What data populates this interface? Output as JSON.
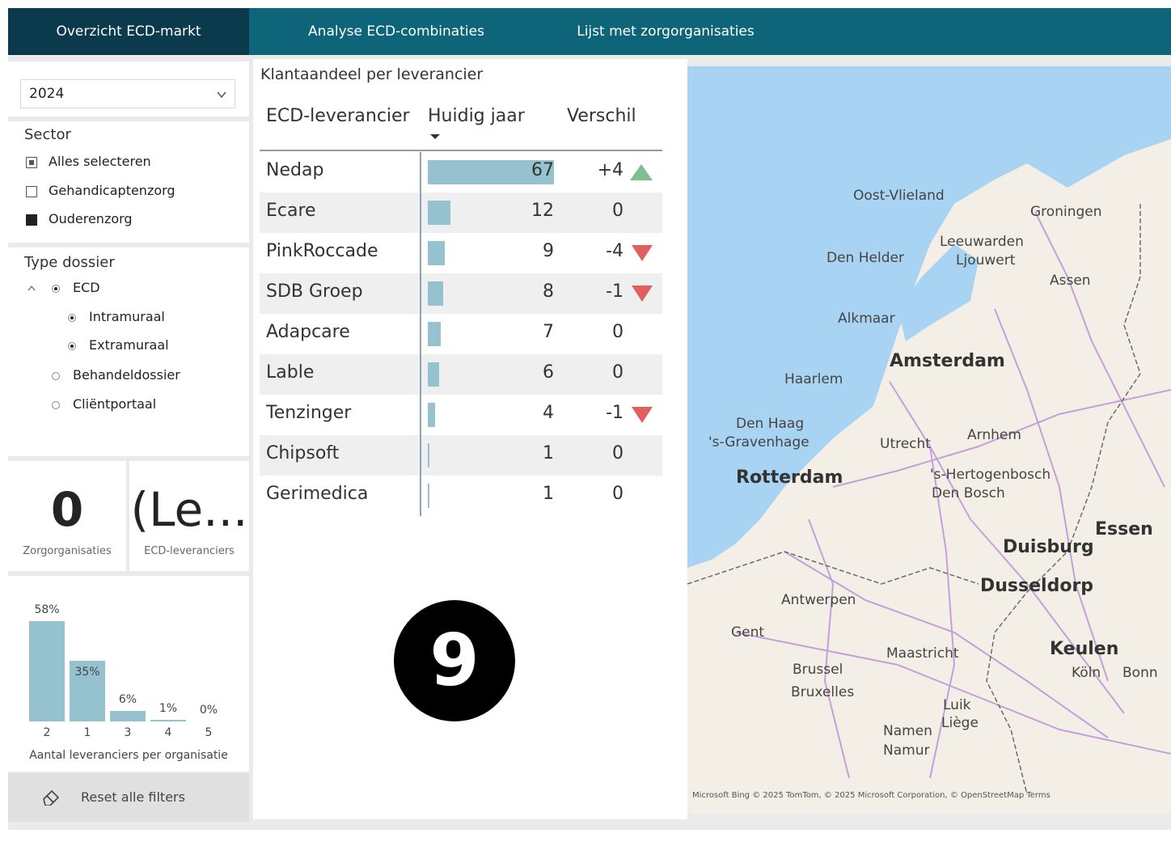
{
  "nav": {
    "tabs": [
      {
        "label": "Overzicht ECD-markt",
        "active": true
      },
      {
        "label": "Analyse ECD-combinaties",
        "active": false
      },
      {
        "label": "Lijst met zorgorganisaties",
        "active": false
      }
    ],
    "active_color": "#0b3a4d",
    "bar_color": "#0e6478"
  },
  "filters": {
    "year": "2024",
    "sector": {
      "title": "Sector",
      "options": [
        {
          "label": "Alles selecteren",
          "state": "partial"
        },
        {
          "label": "Gehandicaptenzorg",
          "state": "unchecked"
        },
        {
          "label": "Ouderenzorg",
          "state": "checked"
        }
      ]
    },
    "dossier": {
      "title": "Type dossier",
      "options": [
        {
          "label": "ECD",
          "selected": true,
          "expanded": true
        },
        {
          "label": "Intramuraal",
          "selected": true
        },
        {
          "label": "Extramuraal",
          "selected": true
        },
        {
          "label": "Behandeldossier",
          "selected": false
        },
        {
          "label": "Cliëntportaal",
          "selected": false
        }
      ]
    }
  },
  "kpis": [
    {
      "value": "0",
      "label": "Zorgorganisaties"
    },
    {
      "value": "(Le...",
      "label": "ECD-leveranciers"
    }
  ],
  "mini_chart": {
    "type": "bar",
    "categories": [
      "2",
      "1",
      "3",
      "4",
      "5"
    ],
    "values": [
      58,
      35,
      6,
      1,
      0
    ],
    "value_labels": [
      "58%",
      "35%",
      "6%",
      "1%",
      "0%"
    ],
    "xlabel": "Aantal leveranciers per organisatie",
    "color": "#96c1cf"
  },
  "reset": {
    "label": "Reset alle filters"
  },
  "table": {
    "title": "Klantaandeel per leverancier",
    "headers": [
      "ECD-leverancier",
      "Huidig jaar",
      "Verschil"
    ],
    "rows": [
      {
        "name": "Nedap",
        "value": 67,
        "value_label": "67",
        "diff": "+4",
        "trend": "up"
      },
      {
        "name": "Ecare",
        "value": 12,
        "value_label": "12",
        "diff": "0",
        "trend": "none"
      },
      {
        "name": "PinkRoccade",
        "value": 9,
        "value_label": "9",
        "diff": "-4",
        "trend": "down"
      },
      {
        "name": "SDB Groep",
        "value": 8,
        "value_label": "8",
        "diff": "-1",
        "trend": "down"
      },
      {
        "name": "Adapcare",
        "value": 7,
        "value_label": "7",
        "diff": "0",
        "trend": "none"
      },
      {
        "name": "Lable",
        "value": 6,
        "value_label": "6",
        "diff": "0",
        "trend": "none"
      },
      {
        "name": "Tenzinger",
        "value": 4,
        "value_label": "4",
        "diff": "-1",
        "trend": "down"
      },
      {
        "name": "Chipsoft",
        "value": 1,
        "value_label": "1",
        "diff": "0",
        "trend": "none"
      },
      {
        "name": "Gerimedica",
        "value": 1,
        "value_label": "1",
        "diff": "0",
        "trend": "none"
      }
    ],
    "bar_color": "#96c1cf",
    "up_color": "#7fbf8f",
    "down_color": "#e06060"
  },
  "badge": {
    "text": "9"
  },
  "map": {
    "labels": [
      {
        "text": "Oost-Vlieland",
        "big": false
      },
      {
        "text": "Groningen",
        "big": false
      },
      {
        "text": "Leeuwarden",
        "big": false
      },
      {
        "text": "Ljouwert",
        "big": false
      },
      {
        "text": "Den Helder",
        "big": false
      },
      {
        "text": "Assen",
        "big": false
      },
      {
        "text": "Alkmaar",
        "big": false
      },
      {
        "text": "Amsterdam",
        "big": true
      },
      {
        "text": "Haarlem",
        "big": false
      },
      {
        "text": "Den Haag",
        "big": false
      },
      {
        "text": "'s-Gravenhage",
        "big": false
      },
      {
        "text": "Utrecht",
        "big": false
      },
      {
        "text": "Arnhem",
        "big": false
      },
      {
        "text": "Rotterdam",
        "big": true
      },
      {
        "text": "'s-Hertogenbosch",
        "big": false
      },
      {
        "text": "Den Bosch",
        "big": false
      },
      {
        "text": "Essen",
        "big": true
      },
      {
        "text": "Duisburg",
        "big": true
      },
      {
        "text": "Dusseldorp",
        "big": true
      },
      {
        "text": "Antwerpen",
        "big": false
      },
      {
        "text": "Gent",
        "big": false
      },
      {
        "text": "Maastricht",
        "big": false
      },
      {
        "text": "Keulen",
        "big": true
      },
      {
        "text": "Köln",
        "big": false
      },
      {
        "text": "Bonn",
        "big": false
      },
      {
        "text": "Brussel",
        "big": false
      },
      {
        "text": "Bruxelles",
        "big": false
      },
      {
        "text": "Luik",
        "big": false
      },
      {
        "text": "Liège",
        "big": false
      },
      {
        "text": "Namen",
        "big": false
      },
      {
        "text": "Namur",
        "big": false
      }
    ],
    "attribution": "Microsoft Bing   © 2025 TomTom, © 2025 Microsoft Corporation, © OpenStreetMap  Terms",
    "sea_color": "#a9d3f2",
    "land_color": "#f3efe6"
  }
}
